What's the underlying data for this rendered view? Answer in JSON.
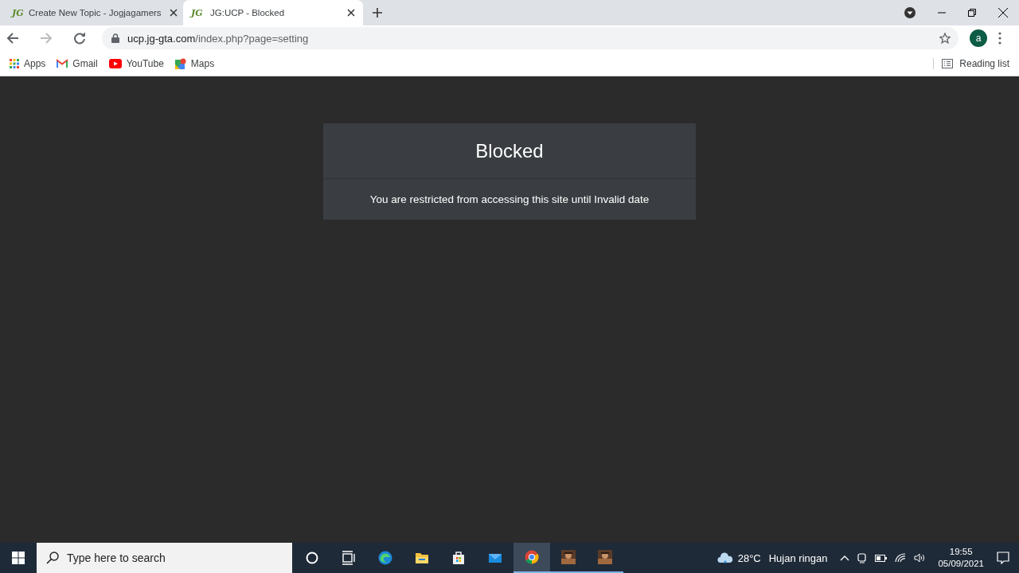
{
  "tabs": [
    {
      "logo": "JG",
      "title": "Create New Topic - Jogjagamers",
      "selected": false
    },
    {
      "logo": "JG",
      "title": "JG:UCP - Blocked",
      "selected": true
    }
  ],
  "address": {
    "host": "ucp.jg-gta.com",
    "path": "/index.php?page=setting"
  },
  "profile": {
    "initial": "a"
  },
  "bookmarks": [
    {
      "kind": "apps",
      "label": "Apps"
    },
    {
      "kind": "gmail",
      "label": "Gmail"
    },
    {
      "kind": "youtube",
      "label": "YouTube"
    },
    {
      "kind": "maps",
      "label": "Maps"
    }
  ],
  "reading_list": {
    "label": "Reading list"
  },
  "card": {
    "title": "Blocked",
    "message": "You are restricted from accessing this site until Invalid date"
  },
  "taskbar": {
    "search_placeholder": "Type here to search",
    "apps": [
      {
        "kind": "cortana"
      },
      {
        "kind": "taskview"
      },
      {
        "kind": "edge"
      },
      {
        "kind": "explorer"
      },
      {
        "kind": "store"
      },
      {
        "kind": "mail"
      },
      {
        "kind": "chrome",
        "selected": true
      },
      {
        "kind": "game",
        "selected": false
      },
      {
        "kind": "game",
        "selected": false
      }
    ],
    "weather": {
      "temp": "28°C",
      "condition": "Hujan ringan"
    },
    "time": "19:55",
    "date": "05/09/2021"
  }
}
